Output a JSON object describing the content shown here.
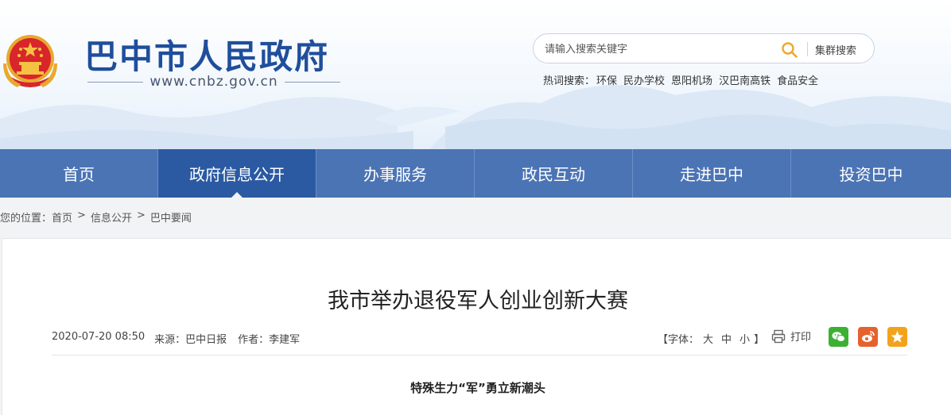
{
  "colors": {
    "brand_blue": "#1f4e9c",
    "nav_bg": "#4b74b5",
    "nav_active": "#2b5aa3",
    "search_icon": "#f0a72a"
  },
  "header": {
    "title": "巴中市人民政府",
    "url": "www.cnbz.gov.cn",
    "emblem_icon": "national-emblem"
  },
  "search": {
    "placeholder": "请输入搜索关键字",
    "button_icon": "search-icon",
    "cluster_label": "集群搜索"
  },
  "hot_words": {
    "label": "热词搜索：",
    "items": [
      "环保",
      "民办学校",
      "恩阳机场",
      "汉巴南高铁",
      "食品安全"
    ]
  },
  "nav": {
    "items": [
      {
        "label": "首页"
      },
      {
        "label": "政府信息公开",
        "active": true
      },
      {
        "label": "办事服务"
      },
      {
        "label": "政民互动"
      },
      {
        "label": "走进巴中"
      },
      {
        "label": "投资巴中"
      }
    ]
  },
  "breadcrumb": {
    "prefix": "您的位置：",
    "items": [
      "首页",
      "信息公开",
      "巴中要闻"
    ],
    "separator": ">"
  },
  "article": {
    "title": "我市举办退役军人创业创新大赛",
    "date": "2020-07-20 08:50",
    "source": "来源：巴中日报",
    "author": "作者：李建军",
    "font_size": {
      "prefix": "【字体：",
      "options": [
        "大",
        "中",
        "小"
      ],
      "suffix": "】"
    },
    "print_label": "打印",
    "share_icons": [
      "wechat-icon",
      "weibo-icon",
      "star-icon"
    ],
    "subtitle": "特殊生力“军”勇立新潮头"
  }
}
